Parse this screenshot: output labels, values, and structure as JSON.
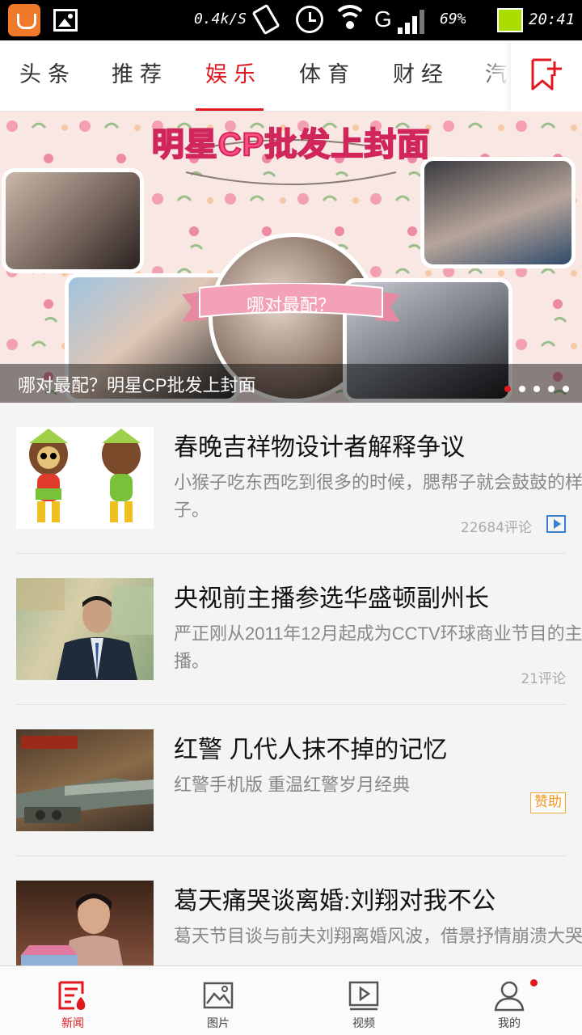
{
  "status_bar": {
    "net_speed": "0.4k/S",
    "network_type": "G",
    "battery": "69%",
    "time": "20:41",
    "icons": [
      "app-notification-icon",
      "image-notification-icon",
      "vibrate-icon",
      "alarm-icon",
      "wifi-icon",
      "signal-icon",
      "battery-icon"
    ]
  },
  "tabs": [
    {
      "label": "头条"
    },
    {
      "label": "推荐"
    },
    {
      "label": "娱乐",
      "active": true
    },
    {
      "label": "体育"
    },
    {
      "label": "财经"
    },
    {
      "label": "汽"
    }
  ],
  "add_channel_icon": "bookmark-plus-icon",
  "banner": {
    "title": "明星CP批发上封面",
    "ribbon": "哪对最配？",
    "caption": "哪对最配？明星CP批发上封面",
    "slide_count": 5,
    "active_slide": 1
  },
  "news": [
    {
      "headline": "春晚吉祥物设计者解释争议",
      "summary": "小猴子吃东西吃到很多的时候，腮帮子就会鼓鼓的样子。",
      "comments": "22684评论",
      "has_video": true
    },
    {
      "headline": "央视前主播参选华盛顿副州长",
      "summary": "严正刚从2011年12月起成为CCTV环球商业节目的主播。",
      "comments": "21评论"
    },
    {
      "headline": "红警 几代人抹不掉的记忆",
      "summary": "红警手机版 重温红警岁月经典",
      "tag": "赞助"
    },
    {
      "headline": "葛天痛哭谈离婚:刘翔对我不公",
      "summary": "葛天节目谈与前夫刘翔离婚风波，借景抒情崩溃大哭"
    }
  ],
  "bottom_nav": [
    {
      "label": "新闻",
      "icon": "news-icon",
      "active": true
    },
    {
      "label": "图片",
      "icon": "picture-icon"
    },
    {
      "label": "视频",
      "icon": "video-icon"
    },
    {
      "label": "我的",
      "icon": "user-icon",
      "badge": true
    }
  ],
  "colors": {
    "accent": "#e0191f",
    "sponsor": "#f0951a",
    "video_badge": "#3a7ed6"
  }
}
